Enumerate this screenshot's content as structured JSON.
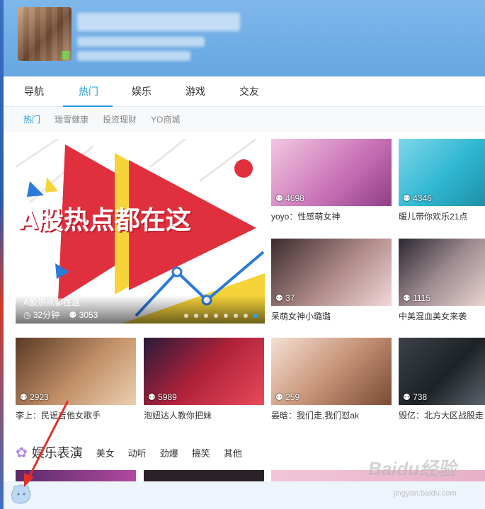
{
  "nav": {
    "tabs": [
      {
        "label": "导航"
      },
      {
        "label": "热门"
      },
      {
        "label": "娱乐"
      },
      {
        "label": "游戏"
      },
      {
        "label": "交友"
      }
    ],
    "active_tab": "热门"
  },
  "subnav": {
    "items": [
      {
        "label": "热门"
      },
      {
        "label": "瑞雪健康"
      },
      {
        "label": "投资理财"
      },
      {
        "label": "YO商城"
      }
    ]
  },
  "banner": {
    "headline": "A股热点都在这",
    "caption_title": "A股热点都在这",
    "duration": "32分钟",
    "viewers": "3053",
    "slide_count": 8,
    "active_slide": 8
  },
  "cards": [
    {
      "title": "yoyo：性感萌女神",
      "count": "4698"
    },
    {
      "title": "暖儿带你欢乐21点",
      "count": "4346"
    },
    {
      "title": "呆萌女神小璐璐",
      "count": "37"
    },
    {
      "title": "中美混血美女来袭",
      "count": "1115"
    },
    {
      "title": "李上：民谣吉他女歌手",
      "count": "2923"
    },
    {
      "title": "泡妞达人教你把妹",
      "count": "5989"
    },
    {
      "title": "晏晗：我们走,我们怼ak",
      "count": "259"
    },
    {
      "title": "毁亿：北方大区战股走",
      "count": "738"
    }
  ],
  "section": {
    "title": "娱乐表演",
    "categories": [
      "美女",
      "动听",
      "劲爆",
      "搞笑",
      "其他"
    ]
  },
  "watermark": {
    "logo": "Baidu经验",
    "url": "jingyan.baidu.com"
  },
  "icons": {
    "viewer": "person-icon",
    "clock": "clock-icon",
    "section": "star-icon",
    "mascot": "mascot-icon"
  },
  "colors": {
    "accent": "#1e9be0",
    "header": "#6ea9e4",
    "banner_red": "#e0303e",
    "banner_yellow": "#f6d33a"
  }
}
